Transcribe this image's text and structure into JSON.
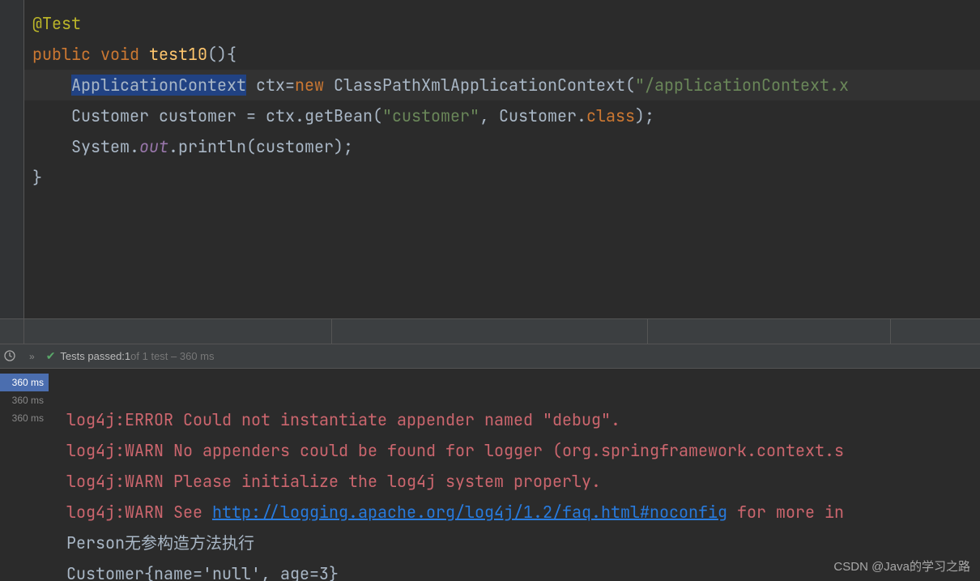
{
  "code": {
    "annotation": "@Test",
    "kw_public": "public",
    "kw_void": "void",
    "method_name": "test10",
    "method_parens": "(){",
    "l3_type": "ApplicationContext",
    "l3_var": " ctx=",
    "l3_new": "new",
    "l3_ctor": " ClassPathXmlApplicationContext(",
    "l3_arg": "\"/applicationContext.x",
    "l4_pre": "Customer customer = ctx.getBean(",
    "l4_str": "\"customer\"",
    "l4_mid": ", Customer.",
    "l4_kw": "class",
    "l4_end": ");",
    "l5_a": "System.",
    "l5_out": "out",
    "l5_b": ".println(customer);",
    "close": "}"
  },
  "tests": {
    "status_prefix": "Tests passed: ",
    "passed": "1",
    "suffix": " of 1 test – 360 ms",
    "times": [
      "360 ms",
      "360 ms",
      "360 ms"
    ]
  },
  "console": {
    "l1": "log4j:ERROR Could not instantiate appender named \"debug\".",
    "l2": "log4j:WARN No appenders could be found for logger (org.springframework.context.s",
    "l3": "log4j:WARN Please initialize the log4j system properly.",
    "l4a": "log4j:WARN See ",
    "l4link": "http://logging.apache.org/log4j/1.2/faq.html#noconfig",
    "l4b": " for more in",
    "l5": "Person无参构造方法执行",
    "l6": "Customer{name='null', age=3}"
  },
  "watermark": "CSDN @Java的学习之路"
}
